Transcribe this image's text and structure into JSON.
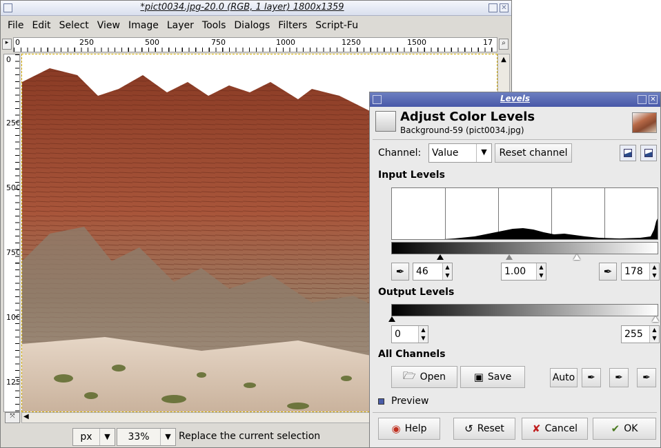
{
  "image_window": {
    "title": "*pict0034.jpg-20.0 (RGB, 1 layer) 1800x1359",
    "menu": [
      "File",
      "Edit",
      "Select",
      "View",
      "Image",
      "Layer",
      "Tools",
      "Dialogs",
      "Filters",
      "Script-Fu"
    ],
    "ruler_top_labels": [
      "0",
      "250",
      "500",
      "750",
      "1000",
      "1250",
      "1500",
      "17"
    ],
    "ruler_left_labels": [
      "0",
      "250",
      "500",
      "750",
      "1000",
      "1250"
    ],
    "status": {
      "unit": "px",
      "zoom": "33%",
      "message": "Replace the current selection"
    }
  },
  "levels_dialog": {
    "title": "Levels",
    "heading": "Adjust Color Levels",
    "subheading": "Background-59 (pict0034.jpg)",
    "channel_label": "Channel:",
    "channel_value": "Value",
    "reset_channel": "Reset channel",
    "input_levels_title": "Input Levels",
    "input_low": "46",
    "gamma": "1.00",
    "input_high": "178",
    "output_levels_title": "Output Levels",
    "output_low": "0",
    "output_high": "255",
    "all_channels_title": "All Channels",
    "buttons": {
      "open": "Open",
      "save": "Save",
      "auto": "Auto",
      "help": "Help",
      "reset": "Reset",
      "cancel": "Cancel",
      "ok": "OK"
    },
    "preview_label": "Preview",
    "preview_checked": true
  }
}
